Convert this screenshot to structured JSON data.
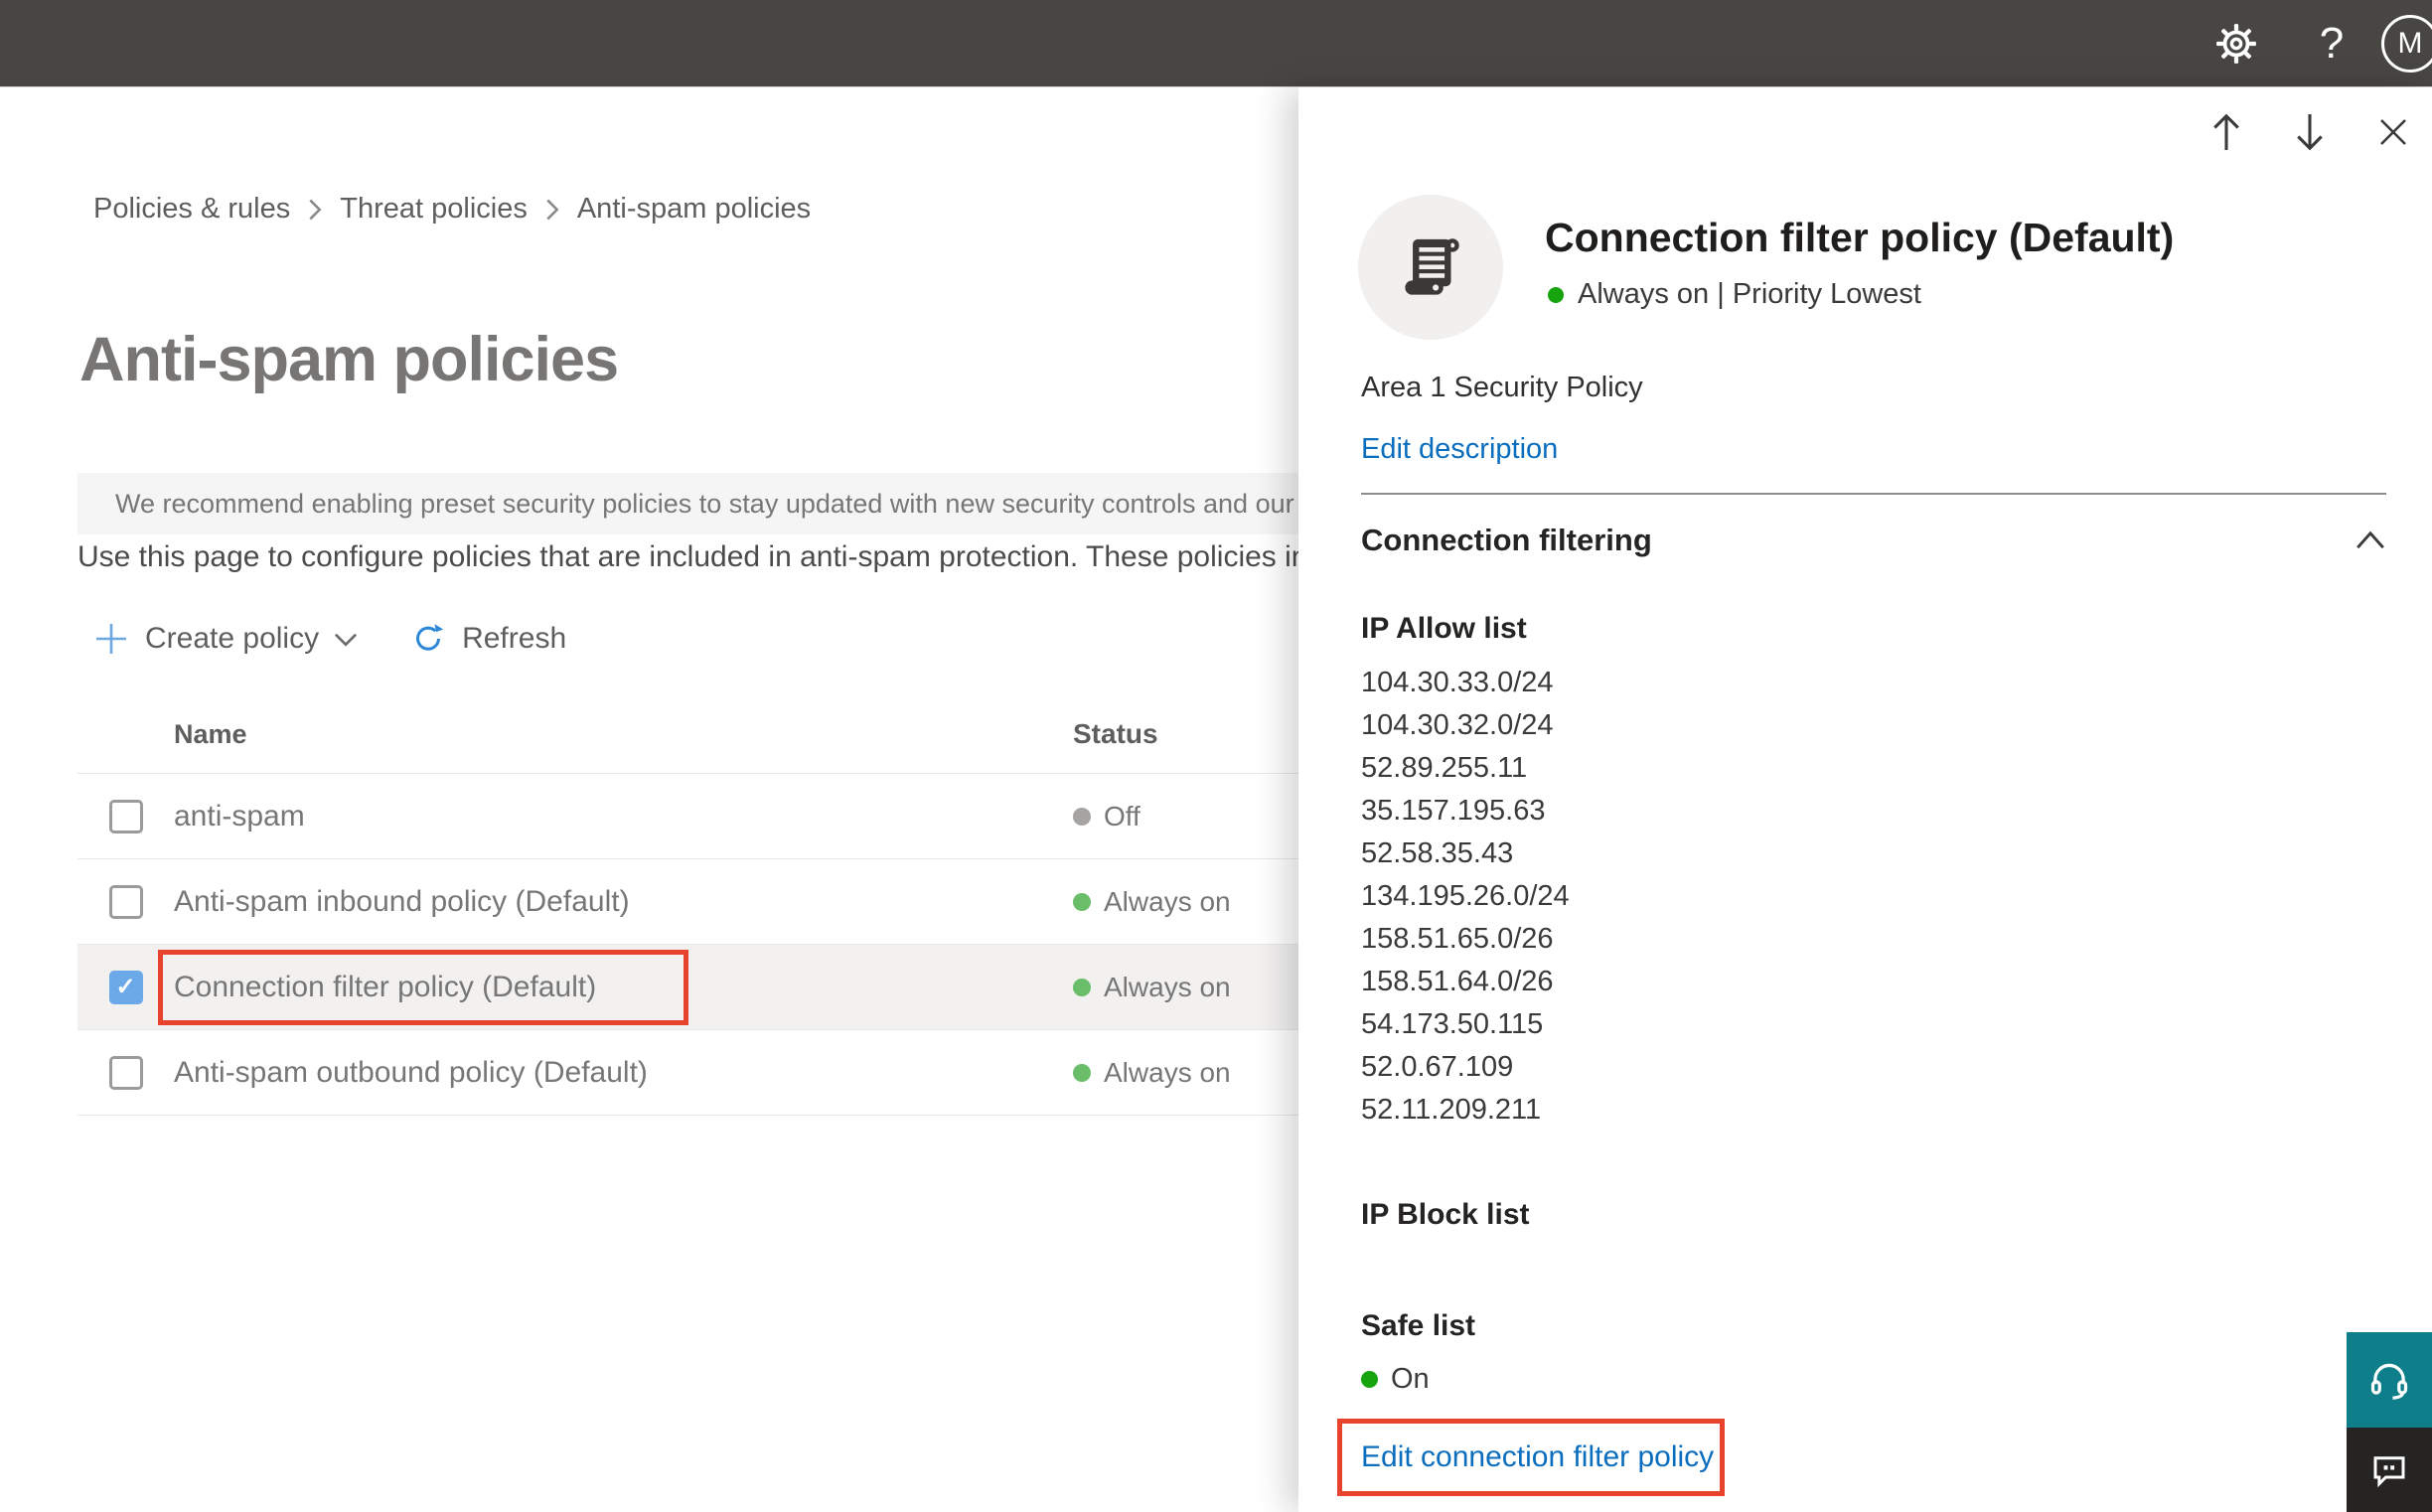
{
  "topbar": {
    "help_glyph": "?",
    "avatar_initial": "M"
  },
  "breadcrumb": {
    "items": [
      "Policies & rules",
      "Threat policies",
      "Anti-spam policies"
    ]
  },
  "page": {
    "title": "Anti-spam policies",
    "recommendation_banner": "We recommend enabling preset security policies to stay updated with new security controls and our recomme",
    "intro": "Use this page to configure policies that are included in anti-spam protection. These policies include"
  },
  "toolbar": {
    "create_policy": "Create policy",
    "refresh": "Refresh"
  },
  "policies_table": {
    "columns": [
      "Name",
      "Status"
    ],
    "rows": [
      {
        "name": "anti-spam",
        "status": "Off",
        "checked": false,
        "selected": false
      },
      {
        "name": "Anti-spam inbound policy (Default)",
        "status": "Always on",
        "checked": false,
        "selected": false
      },
      {
        "name": "Connection filter policy (Default)",
        "status": "Always on",
        "checked": true,
        "selected": true
      },
      {
        "name": "Anti-spam outbound policy (Default)",
        "status": "Always on",
        "checked": false,
        "selected": false
      }
    ]
  },
  "flyout": {
    "title": "Connection filter policy (Default)",
    "status_line": "Always on | Priority Lowest",
    "description": "Area 1 Security Policy",
    "edit_description_label": "Edit description",
    "section_title": "Connection filtering",
    "ip_allow_title": "IP Allow list",
    "ip_allow_list": [
      "104.30.33.0/24",
      "104.30.32.0/24",
      "52.89.255.11",
      "35.157.195.63",
      "52.58.35.43",
      "134.195.26.0/24",
      "158.51.65.0/26",
      "158.51.64.0/26",
      "54.173.50.115",
      "52.0.67.109",
      "52.11.209.211"
    ],
    "ip_block_title": "IP Block list",
    "safe_list_title": "Safe list",
    "safe_list_status": "On",
    "edit_policy_label": "Edit connection filter policy"
  },
  "colors": {
    "topbar_bg": "#474642",
    "accent_blue": "#0b6dbd",
    "annotation_red": "#e8432d",
    "status_green_bright": "#16a50f",
    "status_green_soft": "#6abd69",
    "status_gray": "#a6a4a2",
    "help_teal": "#0e7e8b",
    "feedback_dark": "#252423"
  }
}
